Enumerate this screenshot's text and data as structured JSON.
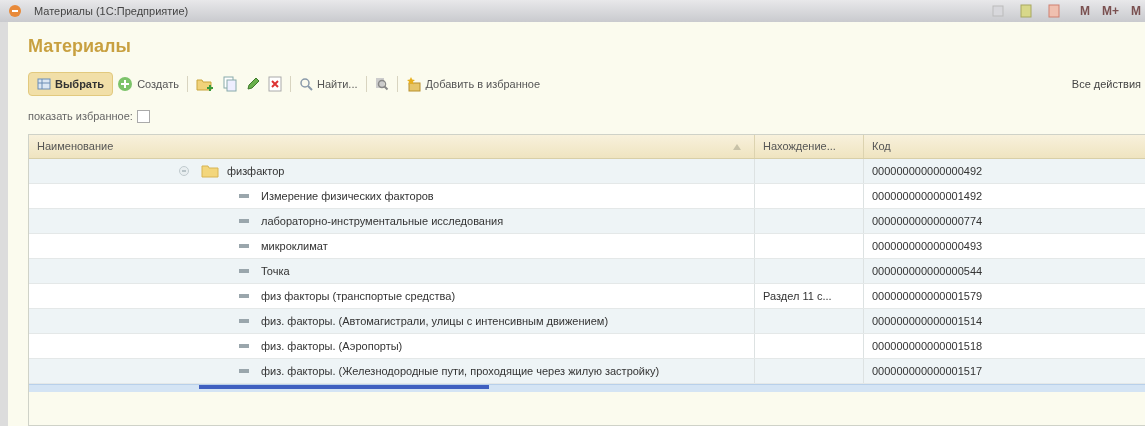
{
  "window": {
    "title": "Материалы  (1С:Предприятие)",
    "memory_buttons": [
      "M",
      "M+",
      "M"
    ]
  },
  "heading": "Материалы",
  "toolbar": {
    "items": [
      {
        "kind": "primary",
        "label": "Выбрать"
      },
      {
        "kind": "create",
        "label": "Создать"
      },
      {
        "kind": "separator"
      },
      {
        "kind": "add-folder"
      },
      {
        "kind": "copy"
      },
      {
        "kind": "edit"
      },
      {
        "kind": "delete"
      },
      {
        "kind": "separator"
      },
      {
        "kind": "find",
        "label": "Найти..."
      },
      {
        "kind": "separator"
      },
      {
        "kind": "cancel-find"
      },
      {
        "kind": "separator"
      },
      {
        "kind": "favorite",
        "label": "Добавить в избранное"
      }
    ],
    "all_actions": "Все действия"
  },
  "show_favorites": {
    "label": "показать избранное:",
    "checked": false
  },
  "table": {
    "columns": [
      "Наименование",
      "Нахождение...",
      "Код"
    ],
    "sort_ascending": true,
    "rows": [
      {
        "kind": "folder",
        "expanded": true,
        "name": "физфактор",
        "code": "000000000000000492",
        "children": [
          {
            "kind": "item",
            "name": "Измерение физических факторов",
            "code": "000000000000001492"
          },
          {
            "kind": "item",
            "name": "лабораторно-инструментальные исследования",
            "code": "000000000000000774"
          },
          {
            "kind": "item",
            "name": "микроклимат",
            "code": "000000000000000493"
          },
          {
            "kind": "item",
            "name": "Точка",
            "code": "000000000000000544"
          },
          {
            "kind": "item",
            "name": "физ факторы (транспортые средства)",
            "location": "Раздел 11 с...",
            "code": "000000000000001579"
          },
          {
            "kind": "item",
            "name": "физ. факторы. (Автомагистрали, улицы с интенсивным движением)",
            "code": "000000000000001514"
          },
          {
            "kind": "item",
            "name": "физ. факторы. (Аэропорты)",
            "code": "000000000000001518"
          },
          {
            "kind": "item",
            "name": "физ. факторы. (Железнодородные пути, проходящие через жилую застройку)",
            "code": "000000000000001517"
          }
        ]
      }
    ]
  }
}
